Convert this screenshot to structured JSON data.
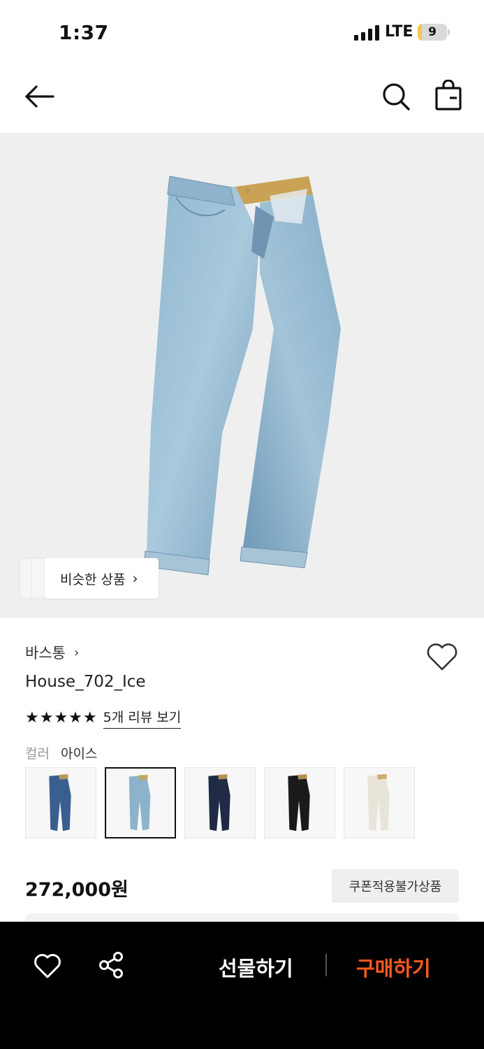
{
  "status_bar": {
    "time": "1:37",
    "network": "LTE",
    "battery_level": "9",
    "battery_color": "#f2c94c"
  },
  "nav": {
    "back_icon": "arrow-left-icon",
    "search_icon": "search-icon",
    "bag_icon": "shopping-bag-icon"
  },
  "hero": {
    "similar_label": "비슷한 상품",
    "similar_chevron": "›",
    "background": "#efefef"
  },
  "product": {
    "brand": "바스통",
    "brand_chevron": "›",
    "title": "House_702_Ice",
    "stars": "★★★★★",
    "review_link": "5개 리뷰 보기",
    "color_label": "컬러",
    "color_value": "아이스",
    "swatches": [
      {
        "color": "#3a5f8f",
        "selected": false
      },
      {
        "color": "#8db3cc",
        "selected": true
      },
      {
        "color": "#1f2a44",
        "selected": false
      },
      {
        "color": "#1a1a1a",
        "selected": false
      },
      {
        "color": "#e8e4da",
        "selected": false
      }
    ],
    "price": "272,000원",
    "coupon_badge": "쿠폰적용불가상품"
  },
  "bottom_bar": {
    "gift_label": "선물하기",
    "buy_label": "구매하기",
    "buy_color": "#ff5a1f",
    "heart_icon": "heart-icon",
    "share_icon": "share-icon"
  }
}
